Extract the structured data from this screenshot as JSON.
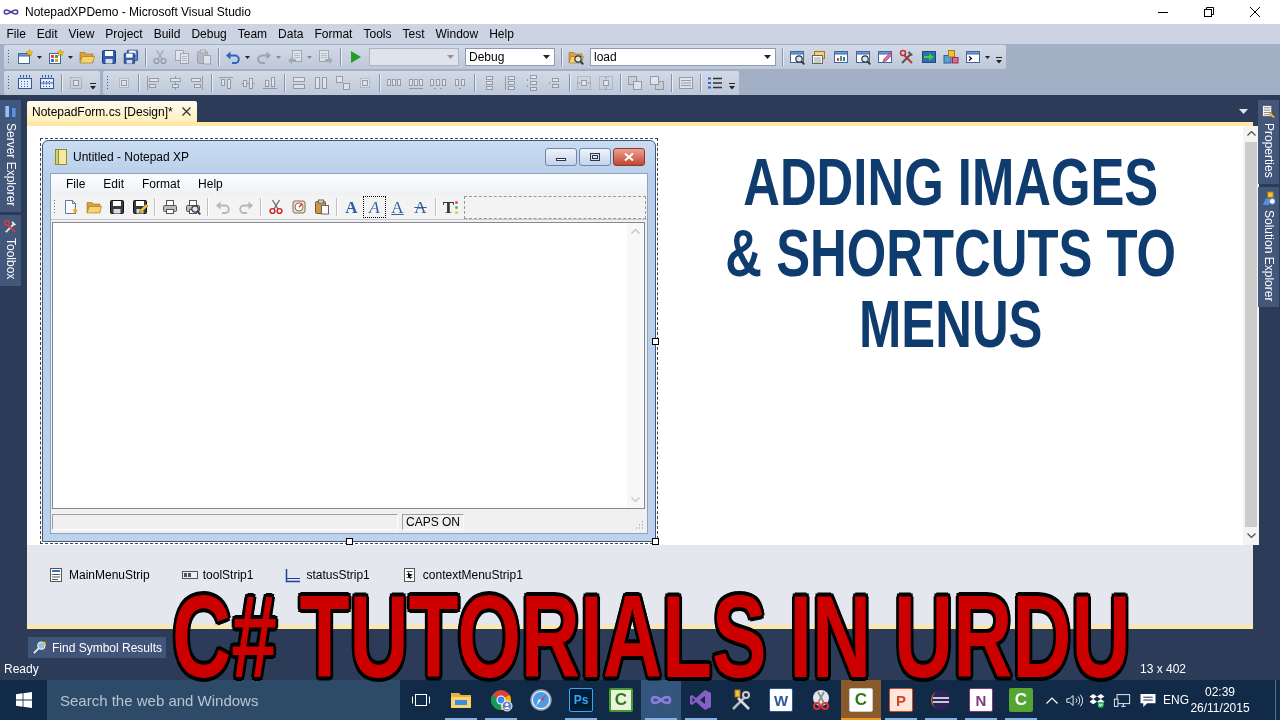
{
  "window": {
    "title": "NotepadXPDemo - Microsoft Visual Studio"
  },
  "menu_bar": [
    "File",
    "Edit",
    "View",
    "Project",
    "Build",
    "Debug",
    "Team",
    "Data",
    "Format",
    "Tools",
    "Test",
    "Window",
    "Help"
  ],
  "toolbar_rows": [
    {
      "toolbars": [
        {
          "items": [
            {
              "kind": "split",
              "disabled": false
            },
            {
              "kind": "split",
              "disabled": false
            },
            {
              "kind": "button",
              "disabled": false
            },
            {
              "kind": "button",
              "disabled": false
            },
            {
              "kind": "button",
              "disabled": false
            },
            {
              "kind": "separator"
            },
            {
              "kind": "button",
              "disabled": true
            },
            {
              "kind": "button",
              "disabled": true
            },
            {
              "kind": "button",
              "disabled": true
            },
            {
              "kind": "separator"
            },
            {
              "kind": "split",
              "disabled": false
            },
            {
              "kind": "split",
              "disabled": true
            },
            {
              "kind": "split",
              "disabled": true
            },
            {
              "kind": "button",
              "disabled": true
            },
            {
              "kind": "separator"
            },
            {
              "kind": "button",
              "disabled": false
            },
            {
              "kind": "combo",
              "disabled": true
            },
            {
              "kind": "combo",
              "disabled": false,
              "value": "Debug"
            },
            {
              "kind": "separator"
            },
            {
              "kind": "button",
              "disabled": false
            },
            {
              "kind": "combo",
              "disabled": false,
              "value": "load"
            },
            {
              "kind": "separator"
            },
            {
              "kind": "button",
              "disabled": false
            },
            {
              "kind": "button",
              "disabled": false
            },
            {
              "kind": "button",
              "disabled": false
            },
            {
              "kind": "button",
              "disabled": false
            },
            {
              "kind": "button",
              "disabled": false
            },
            {
              "kind": "button",
              "disabled": false
            },
            {
              "kind": "button",
              "disabled": false
            },
            {
              "kind": "button",
              "disabled": false
            },
            {
              "kind": "split",
              "disabled": false
            }
          ]
        }
      ]
    },
    {
      "toolbars": [
        {
          "items": [
            {
              "kind": "button",
              "disabled": false
            },
            {
              "kind": "button",
              "disabled": false
            },
            {
              "kind": "separator"
            },
            {
              "kind": "button",
              "disabled": true
            }
          ]
        },
        {
          "items": [
            {
              "kind": "button",
              "disabled": true
            },
            {
              "kind": "separator"
            },
            {
              "kind": "button",
              "disabled": true
            },
            {
              "kind": "button",
              "disabled": true
            },
            {
              "kind": "button",
              "disabled": true
            },
            {
              "kind": "separator"
            },
            {
              "kind": "button",
              "disabled": true
            },
            {
              "kind": "button",
              "disabled": true
            },
            {
              "kind": "button",
              "disabled": true
            },
            {
              "kind": "separator"
            },
            {
              "kind": "button",
              "disabled": true
            },
            {
              "kind": "button",
              "disabled": true
            },
            {
              "kind": "button",
              "disabled": true
            },
            {
              "kind": "button",
              "disabled": true
            },
            {
              "kind": "separator"
            },
            {
              "kind": "button",
              "disabled": true
            },
            {
              "kind": "button",
              "disabled": true
            },
            {
              "kind": "button",
              "disabled": true
            },
            {
              "kind": "button",
              "disabled": true
            },
            {
              "kind": "separator"
            },
            {
              "kind": "button",
              "disabled": true
            },
            {
              "kind": "button",
              "disabled": true
            },
            {
              "kind": "button",
              "disabled": true
            },
            {
              "kind": "button",
              "disabled": true
            },
            {
              "kind": "separator"
            },
            {
              "kind": "button",
              "disabled": true
            },
            {
              "kind": "button",
              "disabled": true
            },
            {
              "kind": "separator"
            },
            {
              "kind": "button",
              "disabled": true
            },
            {
              "kind": "button",
              "disabled": true
            },
            {
              "kind": "separator"
            },
            {
              "kind": "button",
              "disabled": true
            },
            {
              "kind": "separator"
            },
            {
              "kind": "button",
              "disabled": false
            }
          ]
        }
      ]
    }
  ],
  "left_panel_tabs": [
    {
      "label": "Server Explorer"
    },
    {
      "label": "Toolbox"
    }
  ],
  "document_tabs": [
    {
      "label": "NotepadForm.cs [Design]*",
      "selected": true
    }
  ],
  "form": {
    "title": "Untitled - Notepad XP",
    "menu": [
      "File",
      "Edit",
      "Format",
      "Help"
    ],
    "toolstrip": [
      {
        "kind": "button",
        "disabled": false,
        "selected": false
      },
      {
        "kind": "button",
        "disabled": false,
        "selected": false
      },
      {
        "kind": "button",
        "disabled": false,
        "selected": false
      },
      {
        "kind": "button",
        "disabled": false,
        "selected": false
      },
      {
        "kind": "separator"
      },
      {
        "kind": "button",
        "disabled": false,
        "selected": false
      },
      {
        "kind": "button",
        "disabled": false,
        "selected": false
      },
      {
        "kind": "separator"
      },
      {
        "kind": "button",
        "disabled": true,
        "selected": false
      },
      {
        "kind": "button",
        "disabled": true,
        "selected": false
      },
      {
        "kind": "separator"
      },
      {
        "kind": "button",
        "disabled": false,
        "selected": false
      },
      {
        "kind": "button",
        "disabled": false,
        "selected": false
      },
      {
        "kind": "button",
        "disabled": false,
        "selected": false
      },
      {
        "kind": "separator"
      },
      {
        "kind": "bold",
        "text": "A",
        "disabled": false,
        "selected": false
      },
      {
        "kind": "italic",
        "text": "A",
        "disabled": false,
        "selected": true
      },
      {
        "kind": "underline",
        "text": "A",
        "disabled": false,
        "selected": false
      },
      {
        "kind": "strike",
        "text": "A",
        "disabled": false,
        "selected": false
      },
      {
        "kind": "separator"
      },
      {
        "kind": "color",
        "text": "T",
        "disabled": false,
        "selected": false
      }
    ],
    "status_label": "CAPS ON"
  },
  "designer_heading": [
    "ADDING IMAGES",
    "& SHORTCUTS TO",
    "MENUS"
  ],
  "component_tray": [
    {
      "label": "MainMenuStrip"
    },
    {
      "label": "toolStrip1"
    },
    {
      "label": "statusStrip1"
    },
    {
      "label": "contextMenuStrip1"
    }
  ],
  "right_panel_tabs": [
    {
      "label": "Properties"
    },
    {
      "label": "Solution Explorer"
    }
  ],
  "tool_window_tabs": [
    {
      "label": "Find Symbol Results"
    }
  ],
  "status_bar": {
    "text": "Ready",
    "size": "13 x 402"
  },
  "overlay_title": "C# TUTORIALS IN URDU",
  "taskbar": {
    "search": {
      "placeholder": "Search the web and Windows"
    },
    "apps": [
      {
        "kind": "icon",
        "running": true,
        "selected": false,
        "flashing": false
      },
      {
        "kind": "icon",
        "running": true,
        "selected": false,
        "flashing": false
      },
      {
        "kind": "icon",
        "running": false,
        "selected": false,
        "flashing": false
      },
      {
        "kind": "glyph",
        "text": "Ps",
        "running": true,
        "selected": false,
        "flashing": false
      },
      {
        "kind": "glyph",
        "text": "C",
        "running": false,
        "selected": false,
        "flashing": false
      },
      {
        "kind": "icon",
        "running": true,
        "selected": true,
        "flashing": false
      },
      {
        "kind": "icon",
        "running": true,
        "selected": false,
        "flashing": false
      },
      {
        "kind": "icon",
        "running": false,
        "selected": false,
        "flashing": false
      },
      {
        "kind": "glyph",
        "text": "W",
        "running": false,
        "selected": false,
        "flashing": false
      },
      {
        "kind": "icon",
        "running": false,
        "selected": false,
        "flashing": false
      },
      {
        "kind": "glyph",
        "text": "C",
        "running": true,
        "selected": false,
        "flashing": true
      },
      {
        "kind": "glyph",
        "text": "P",
        "running": true,
        "selected": false,
        "flashing": false
      },
      {
        "kind": "icon",
        "running": true,
        "selected": false,
        "flashing": false
      },
      {
        "kind": "glyph",
        "text": "N",
        "running": true,
        "selected": false,
        "flashing": false
      },
      {
        "kind": "glyph",
        "text": "C",
        "running": true,
        "selected": false,
        "flashing": false
      }
    ],
    "tray": {
      "language": "ENG",
      "time": "02:39",
      "date": "26/11/2015"
    }
  }
}
